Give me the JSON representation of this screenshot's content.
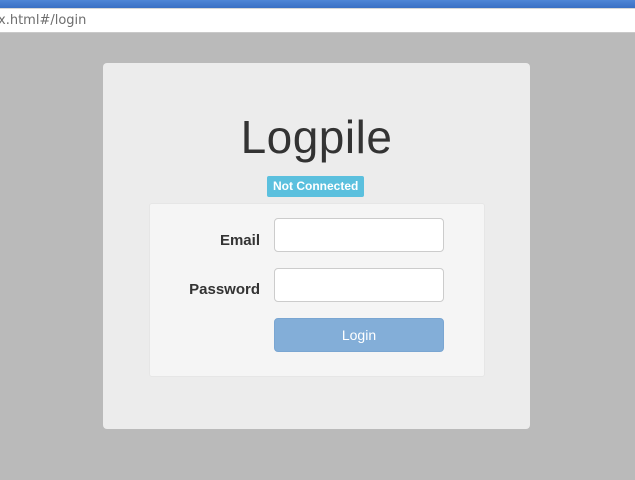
{
  "browser": {
    "address_text": "x.html#/login"
  },
  "app": {
    "title": "Logpile",
    "status": "Not Connected",
    "status_color": "#5bc0de"
  },
  "login_form": {
    "email_label": "Email",
    "email_value": "",
    "password_label": "Password",
    "password_value": "",
    "login_label": "Login",
    "login_color": "#83aed8"
  }
}
